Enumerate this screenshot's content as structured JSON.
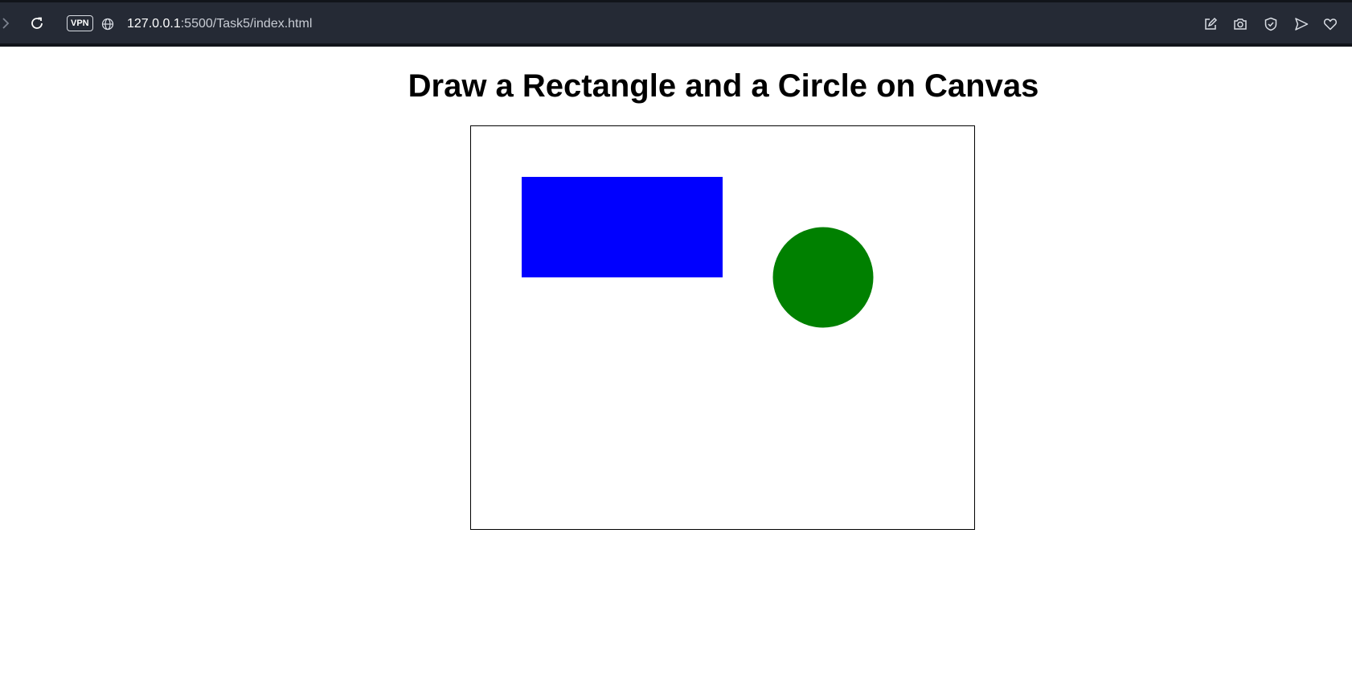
{
  "browser": {
    "vpn_label": "VPN",
    "url_host": "127.0.0.1",
    "url_rest": ":5500/Task5/index.html",
    "icons": {
      "forward": "chevron-right-icon",
      "reload": "reload-icon",
      "site_info": "globe-icon",
      "right": [
        "edit-icon",
        "camera-icon",
        "shield-check-icon",
        "send-icon",
        "heart-icon"
      ]
    }
  },
  "page": {
    "title": "Draw a Rectangle and a Circle on Canvas",
    "canvas": {
      "border_color": "#000000",
      "rectangle_color": "#0000ff",
      "circle_color": "#008000"
    }
  }
}
